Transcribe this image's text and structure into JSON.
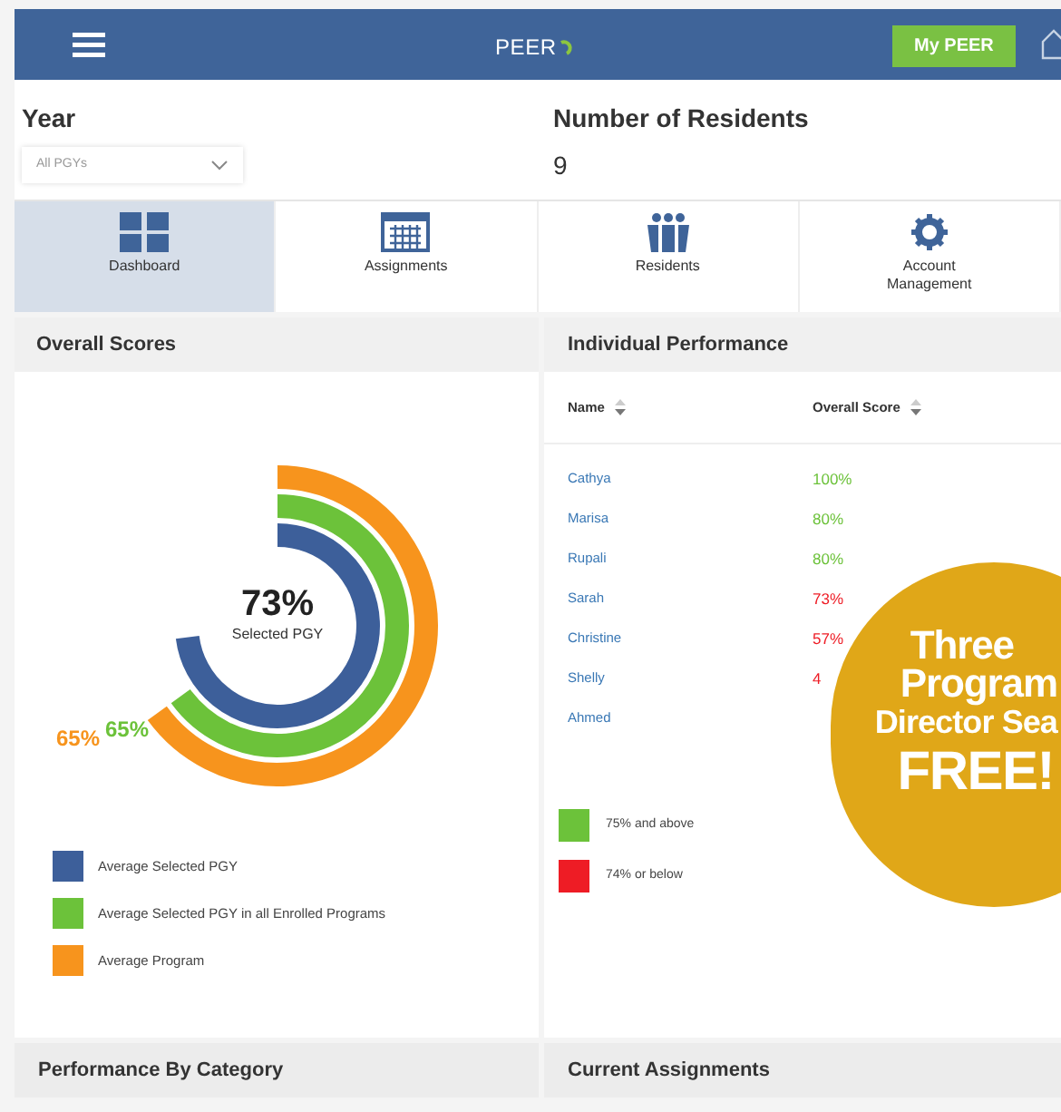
{
  "header": {
    "logo": "PEER",
    "my_button": "My PEER"
  },
  "filters": {
    "year_label": "Year",
    "year_value": "All PGYs",
    "residents_label": "Number of Residents",
    "residents_value": "9"
  },
  "tabs": [
    {
      "label": "Dashboard",
      "selected": true
    },
    {
      "label": "Assignments",
      "selected": false
    },
    {
      "label": "Residents",
      "selected": false
    },
    {
      "label": "Account Management",
      "selected": false
    }
  ],
  "overall_scores": {
    "title": "Overall Scores",
    "center_value": "73%",
    "center_label": "Selected PGY",
    "rings": [
      {
        "name": "Average Selected PGY",
        "color": "#3d5f9a"
      },
      {
        "name": "Average Selected PGY in all Enrolled Programs",
        "color": "#6cc23a",
        "reading": "65%"
      },
      {
        "name": "Average Program",
        "color": "#f7941d",
        "reading": "65%"
      }
    ]
  },
  "individual_performance": {
    "title": "Individual Performance",
    "columns": [
      "Name",
      "Overall Score"
    ],
    "rows": [
      {
        "name": "Cathya",
        "score": "100%",
        "color": "#6cc23a"
      },
      {
        "name": "Marisa",
        "score": "80%",
        "color": "#6cc23a"
      },
      {
        "name": "Rupali",
        "score": "80%",
        "color": "#6cc23a"
      },
      {
        "name": "Sarah",
        "score": "73%",
        "color": "#ee1c25"
      },
      {
        "name": "Christine",
        "score": "57%",
        "color": "#ee1c25"
      },
      {
        "name": "Shelly",
        "score": "4",
        "color": "#ee1c25"
      },
      {
        "name": "Ahmed"
      }
    ],
    "legend": [
      {
        "label": "75% and above",
        "color": "#6cc23a"
      },
      {
        "label": "74% or below",
        "color": "#ee1c25"
      }
    ]
  },
  "bottom_panels": [
    "Performance By Category",
    "Current Assignments"
  ],
  "promo_badge": {
    "lines": [
      "Three",
      "Program",
      "Director Sea",
      "FREE!"
    ]
  }
}
